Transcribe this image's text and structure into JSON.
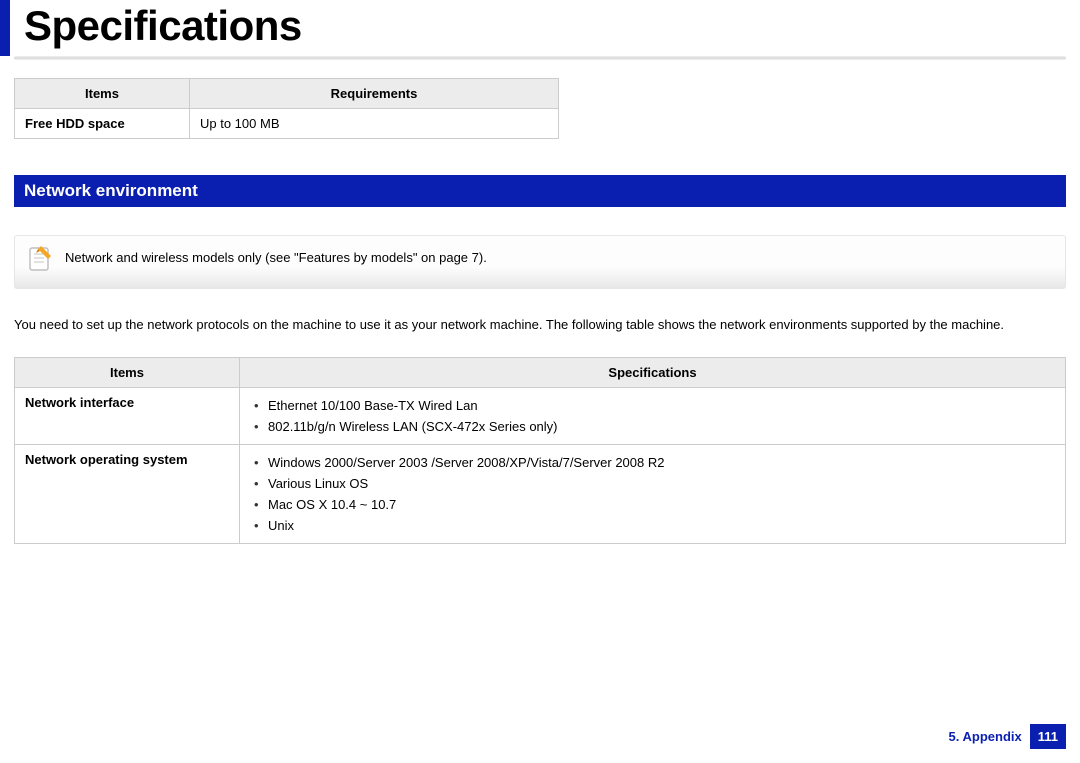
{
  "title": "Specifications",
  "table1": {
    "headers": [
      "Items",
      "Requirements"
    ],
    "rows": [
      {
        "label": "Free HDD space",
        "value": "Up to 100 MB"
      }
    ]
  },
  "section_header": "Network environment",
  "note_text": "Network and wireless models only (see \"Features by models\" on page 7).",
  "intro": "You need to set up the network protocols on the machine to use it as your network machine. The following table shows the network environments supported by the machine.",
  "table2": {
    "headers": [
      "Items",
      "Specifications"
    ],
    "rows": [
      {
        "label": "Network interface",
        "bullets": [
          "Ethernet 10/100 Base-TX Wired Lan",
          "802.11b/g/n Wireless LAN (SCX-472x Series only)"
        ]
      },
      {
        "label": "Network operating system",
        "bullets": [
          "Windows 2000/Server 2003 /Server 2008/XP/Vista/7/Server 2008 R2",
          "Various Linux OS",
          "Mac OS X 10.4 ~ 10.7",
          "Unix"
        ]
      }
    ]
  },
  "footer": {
    "chapter": "5.  Appendix",
    "page": "111"
  }
}
